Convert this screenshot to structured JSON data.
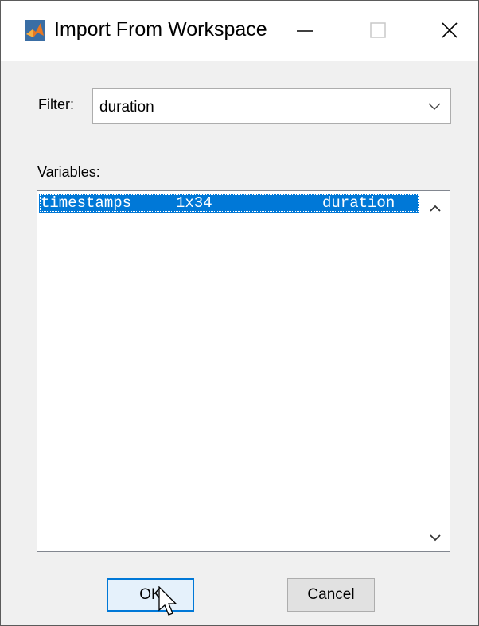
{
  "window": {
    "title": "Import From Workspace"
  },
  "icons": {
    "app": "matlab-icon",
    "minimize": "minimize-icon",
    "maximize": "maximize-icon",
    "close": "close-icon",
    "dropdown": "chevron-down-icon",
    "scroll_up": "chevron-up-icon",
    "scroll_down": "chevron-down-icon",
    "cursor": "mouse-pointer-icon"
  },
  "filter": {
    "label": "Filter:",
    "value": "duration"
  },
  "variables": {
    "label": "Variables:",
    "rows": [
      {
        "name": "timestamps",
        "size": "1x34",
        "class": "duration",
        "selected": true
      }
    ]
  },
  "buttons": {
    "ok": "OK",
    "cancel": "Cancel"
  },
  "colors": {
    "selection": "#0078d7",
    "background": "#f0f0f0",
    "titlebar": "#ffffff"
  }
}
